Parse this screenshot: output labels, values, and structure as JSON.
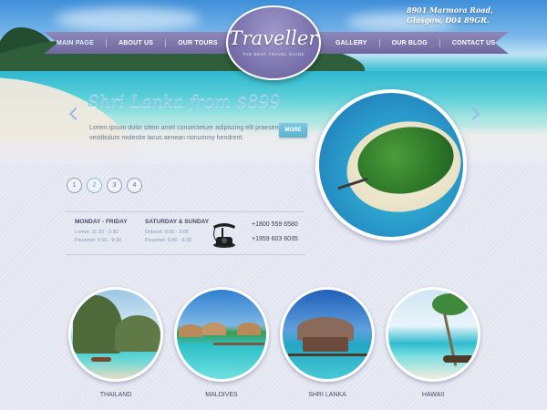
{
  "header": {
    "address_line1": "8901 Marmora Road,",
    "address_line2": "Glasgow, D04 89GR."
  },
  "logo": {
    "title": "Traveller",
    "tagline": "THE BEST TRAVEL GUIDE"
  },
  "nav": {
    "left": [
      "MAIN PAGE",
      "ABOUT US",
      "OUR TOURS"
    ],
    "right": [
      "GALLERY",
      "OUR BLOG",
      "CONTACT US"
    ],
    "active": "MAIN PAGE"
  },
  "slide": {
    "title": "Shri Lanka from $899",
    "text": "Lorem ipsum dolor sitem amet consectetuer adipiscing elit praesent vestibulum molestie lacus aenean nonummy hendrerit.",
    "more_label": "MORE"
  },
  "pager": [
    "1",
    "2",
    "3",
    "4"
  ],
  "pager_active": "2",
  "hours": {
    "weekdays_title": "MONDAY - FRIDAY",
    "weekdays_line1": "Lorem: 11:30 - 2:30",
    "weekdays_line2": "Psuamet: 5:00 - 9:30",
    "weekend_title": "SATURDAY & SUNDAY",
    "weekend_line1": "Dolorsit: 9:00 - 3:00",
    "weekend_line2": "Psuamet: 5:00 - 9:30"
  },
  "phones": [
    "+1800 559 6580",
    "+1959 603 6035"
  ],
  "destinations": [
    "THAILAND",
    "MALDIVES",
    "SHRI LANKA",
    "HAWAII"
  ],
  "colors": {
    "ribbon": "#7a73aa",
    "accent": "#8fc7e4",
    "button": "#66bcd6",
    "background": "#e9ebf4"
  }
}
